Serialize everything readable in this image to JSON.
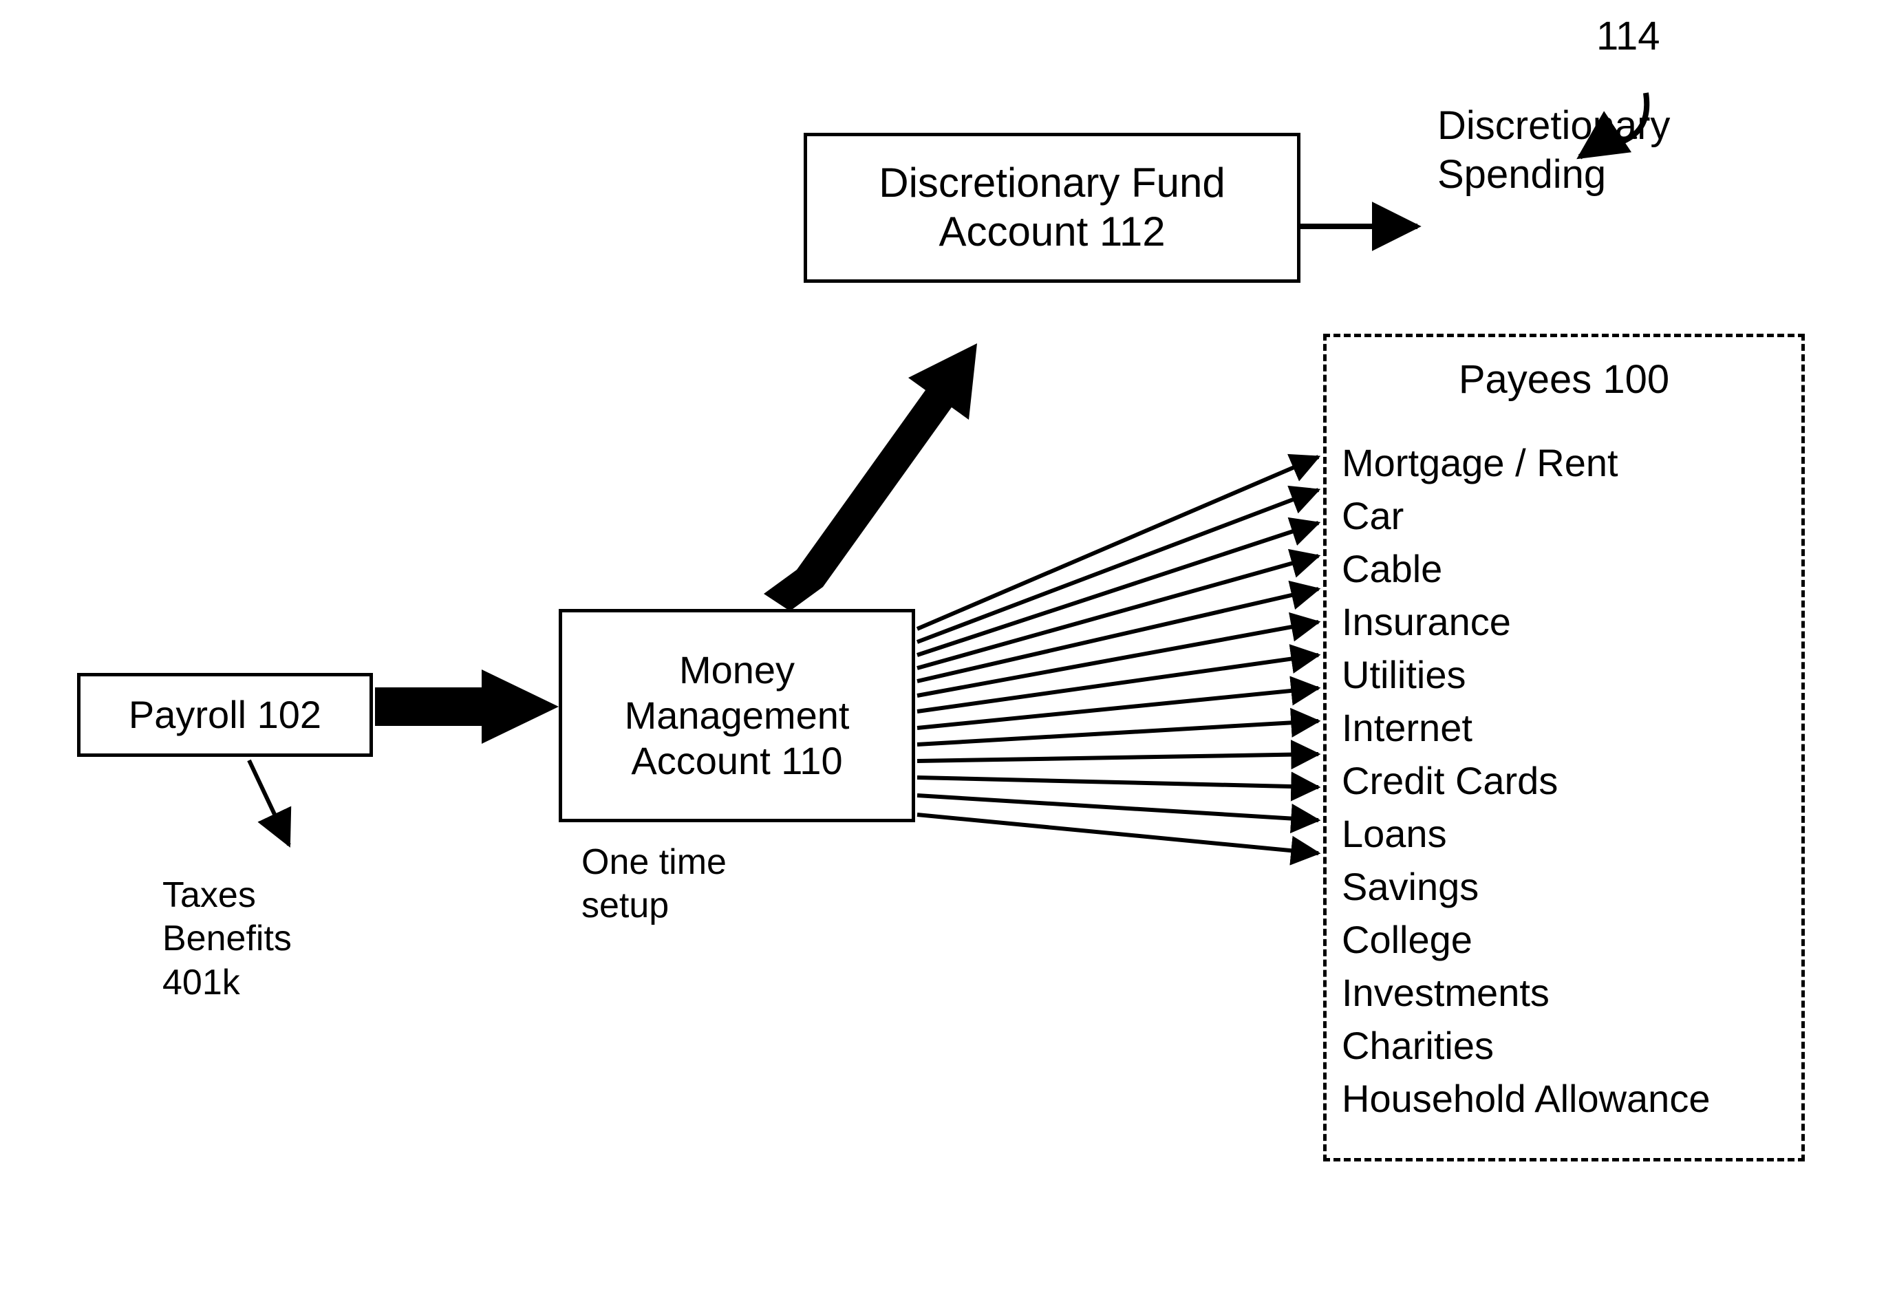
{
  "diagram": {
    "nodes": {
      "payroll": {
        "lines": [
          "Payroll 102"
        ]
      },
      "discretionary_fund": {
        "lines": [
          "Discretionary Fund",
          "Account 112"
        ]
      },
      "money_management": {
        "lines": [
          "Money",
          "Management",
          "Account 110"
        ]
      }
    },
    "labels": {
      "deductions": "Taxes\nBenefits\n401k",
      "one_time_setup": "One time\nsetup",
      "discretionary_spending": "Discretionary\nSpending",
      "reference_114": "114"
    },
    "payees_panel": {
      "title": "Payees 100",
      "items": [
        "Mortgage / Rent",
        "Car",
        "Cable",
        "Insurance",
        "Utilities",
        "Internet",
        "Credit Cards",
        "Loans",
        "Savings",
        "College",
        "Investments",
        "Charities",
        "Household Allowance"
      ]
    },
    "colors": {
      "ink": "#000000",
      "background": "#ffffff"
    }
  }
}
